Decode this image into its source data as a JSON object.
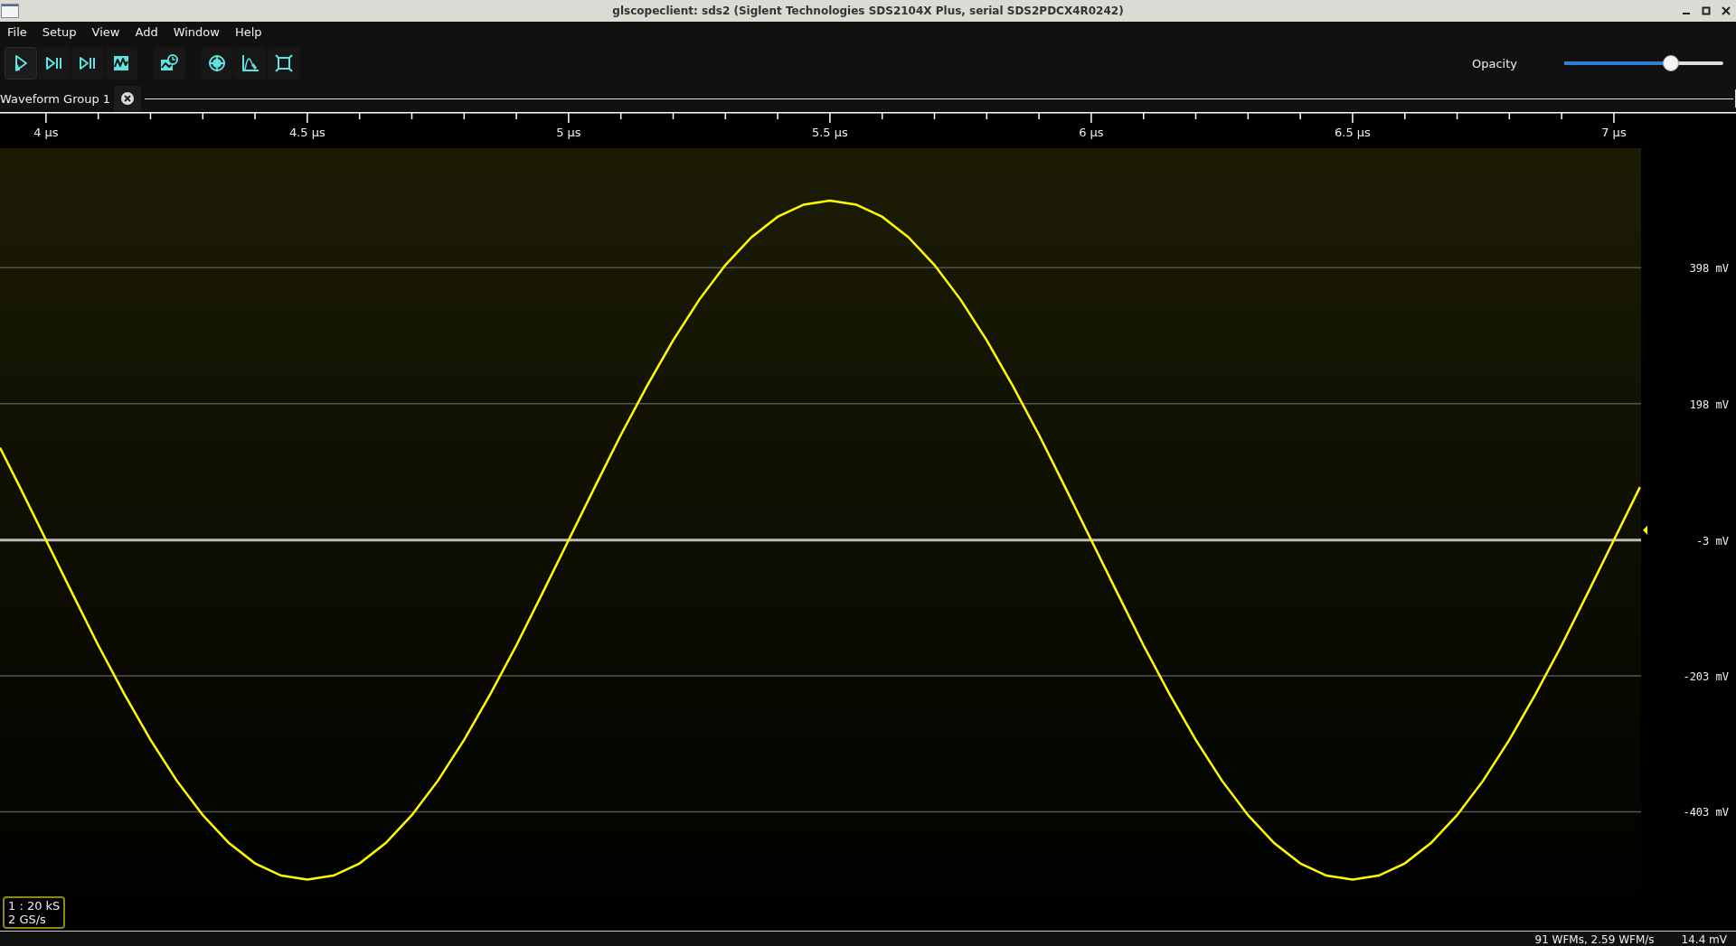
{
  "window": {
    "title": "glscopeclient: sds2 (Siglent Technologies SDS2104X Plus, serial SDS2PDCX4R0242)"
  },
  "menu": [
    "File",
    "Setup",
    "View",
    "Add",
    "Window",
    "Help"
  ],
  "toolbar": [
    {
      "kind": "start",
      "active": true
    },
    {
      "kind": "single",
      "active": false
    },
    {
      "kind": "force",
      "active": false
    },
    {
      "kind": "waveform",
      "active": false
    },
    {
      "kind": "history",
      "active": false
    },
    {
      "kind": "refresh",
      "active": false
    },
    {
      "kind": "plot",
      "active": false
    },
    {
      "kind": "fullscreen",
      "active": false
    }
  ],
  "opacity": {
    "label": "Opacity",
    "level": 0.67
  },
  "tab": {
    "label": "Waveform Group 1"
  },
  "waveform": {
    "info": [
      "1 : 20 kS",
      "2 GS/s"
    ],
    "chart_data": {
      "type": "line",
      "grid": true,
      "xlim": [
        3.912,
        7.052
      ],
      "ylim": [
        -578,
        574
      ],
      "xticks": [
        {
          "value": 4,
          "label": "4 µs"
        },
        {
          "value": 4.5,
          "label": "4.5 µs"
        },
        {
          "value": 5,
          "label": "5 µs"
        },
        {
          "value": 5.5,
          "label": "5.5 µs"
        },
        {
          "value": 6,
          "label": "6 µs"
        },
        {
          "value": 6.5,
          "label": "6.5 µs"
        },
        {
          "value": 7,
          "label": "7 µs"
        }
      ],
      "yticks": [
        {
          "value": 398,
          "label": "398 mV"
        },
        {
          "value": 198,
          "label": "198 mV"
        },
        {
          "value": -3,
          "label": "-3 mV"
        },
        {
          "value": -203,
          "label": "-203 mV"
        },
        {
          "value": -403,
          "label": "-403 mV"
        }
      ],
      "x": [
        3.912,
        3.95,
        4,
        4.05,
        4.1,
        4.15,
        4.2,
        4.25,
        4.3,
        4.35,
        4.4,
        4.45,
        4.5,
        4.55,
        4.6,
        4.65,
        4.7,
        4.75,
        4.8,
        4.85,
        4.9,
        4.95,
        5,
        5.05,
        5.1,
        5.15,
        5.2,
        5.25,
        5.3,
        5.35,
        5.4,
        5.45,
        5.5,
        5.55,
        5.6,
        5.65,
        5.7,
        5.75,
        5.8,
        5.85,
        5.9,
        5.95,
        6,
        6.05,
        6.1,
        6.15,
        6.2,
        6.25,
        6.3,
        6.35,
        6.4,
        6.45,
        6.5,
        6.55,
        6.6,
        6.65,
        6.7,
        6.75,
        6.8,
        6.85,
        6.9,
        6.95,
        7,
        7.05
      ],
      "series": [
        {
          "color": "#ffff00",
          "values": [
            133,
            75,
            -3,
            -81,
            -158,
            -230,
            -297,
            -357,
            -408,
            -449,
            -479,
            -497,
            -503,
            -497,
            -479,
            -449,
            -408,
            -357,
            -297,
            -230,
            -158,
            -81,
            -3,
            75,
            152,
            224,
            291,
            351,
            402,
            443,
            473,
            491,
            497,
            491,
            473,
            443,
            402,
            351,
            291,
            224,
            152,
            75,
            -3,
            -81,
            -158,
            -230,
            -297,
            -357,
            -408,
            -449,
            -479,
            -497,
            -503,
            -497,
            -479,
            -449,
            -408,
            -357,
            -297,
            -230,
            -158,
            -81,
            -3,
            75
          ]
        }
      ]
    }
  },
  "status_bar": [
    "91 WFMs, 2.59 WFM/s",
    "14.4 mV"
  ]
}
